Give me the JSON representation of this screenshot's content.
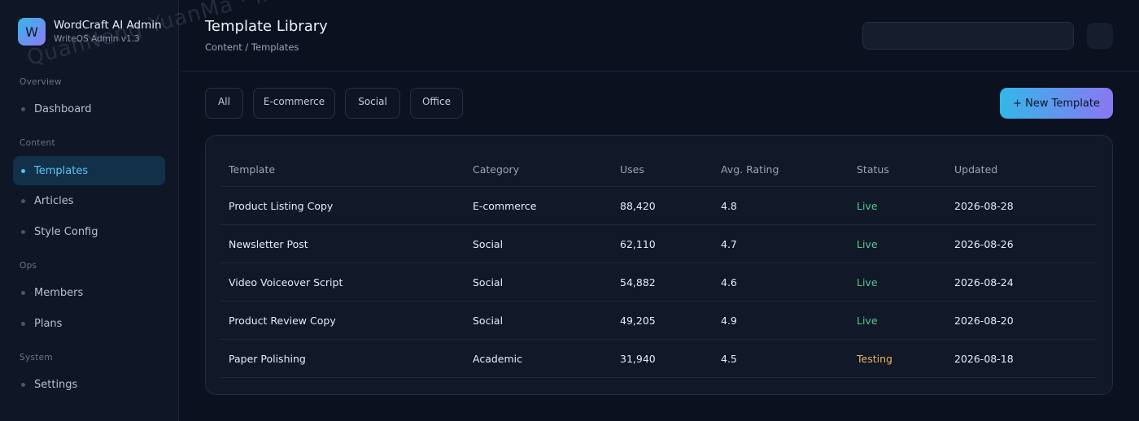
{
  "app": {
    "logo_letter": "W",
    "title": "WordCraft AI Admin",
    "subtitle": "WriteOS Admin v1.3"
  },
  "sidebar": {
    "sections": [
      {
        "label": "Overview",
        "items": [
          {
            "label": "Dashboard",
            "active": false
          }
        ]
      },
      {
        "label": "Content",
        "items": [
          {
            "label": "Templates",
            "active": true
          },
          {
            "label": "Articles",
            "active": false
          },
          {
            "label": "Style Config",
            "active": false
          }
        ]
      },
      {
        "label": "Ops",
        "items": [
          {
            "label": "Members",
            "active": false
          },
          {
            "label": "Plans",
            "active": false
          }
        ]
      },
      {
        "label": "System",
        "items": [
          {
            "label": "Settings",
            "active": false
          }
        ]
      }
    ]
  },
  "header": {
    "title": "Template Library",
    "breadcrumb": "Content / Templates",
    "search_value": ""
  },
  "filters": [
    "All",
    "E-commerce",
    "Social",
    "Office"
  ],
  "new_button_label": "+ New Template",
  "table": {
    "columns": [
      "Template",
      "Category",
      "Uses",
      "Avg. Rating",
      "Status",
      "Updated"
    ],
    "rows": [
      [
        "Product Listing Copy",
        "E-commerce",
        "88,420",
        "4.8",
        "Live",
        "2026-08-28"
      ],
      [
        "Newsletter Post",
        "Social",
        "62,110",
        "4.7",
        "Live",
        "2026-08-26"
      ],
      [
        "Video Voiceover Script",
        "Social",
        "54,882",
        "4.6",
        "Live",
        "2026-08-24"
      ],
      [
        "Product Review Copy",
        "Social",
        "49,205",
        "4.9",
        "Live",
        "2026-08-20"
      ],
      [
        "Paper Polishing",
        "Academic",
        "31,940",
        "4.5",
        "Testing",
        "2026-08-18"
      ]
    ]
  },
  "colors": {
    "accent": "#47c6f0",
    "status_live": "#4ecb8f",
    "status_testing": "#e6b45a"
  },
  "watermark": "QuanNeng YuanMa · inzyxuashop.com"
}
